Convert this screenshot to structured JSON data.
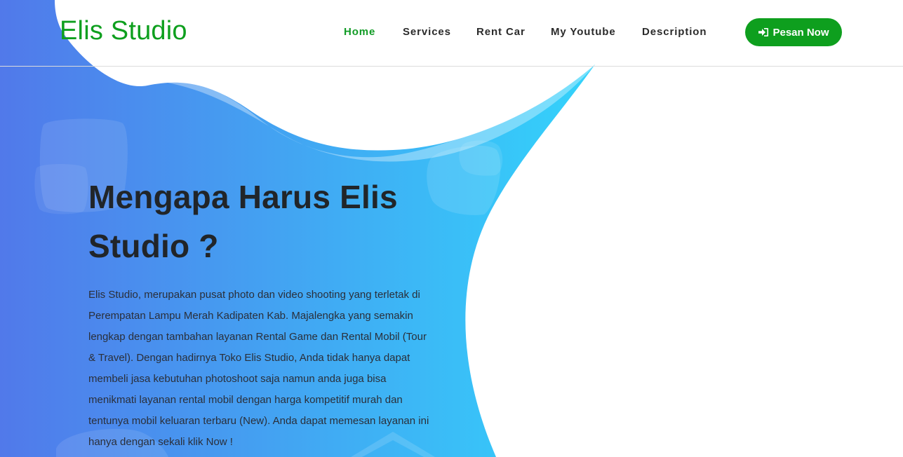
{
  "brand": {
    "name": "Elis Studio",
    "color": "#0e9f1e"
  },
  "nav": {
    "items": [
      {
        "label": "Home",
        "active": true
      },
      {
        "label": "Services",
        "active": false
      },
      {
        "label": "Rent Car",
        "active": false
      },
      {
        "label": "My Youtube",
        "active": false
      },
      {
        "label": "Description",
        "active": false
      }
    ],
    "cta": {
      "label": "Pesan Now",
      "icon": "sign-in-icon"
    }
  },
  "hero": {
    "title": "Mengapa Harus Elis Studio ?",
    "description": "Elis Studio, merupakan pusat photo dan video shooting yang terletak di Perempatan Lampu Merah Kadipaten Kab. Majalengka yang semakin lengkap dengan tambahan layanan Rental Game dan Rental Mobil (Tour & Travel). Dengan hadirnya Toko Elis Studio, Anda tidak hanya dapat membeli jasa kebutuhan photoshoot saja namun anda juga bisa menikmati layanan rental mobil dengan harga kompetitif murah dan tentunya mobil keluaran terbaru (New). Anda dapat memesan layanan ini hanya dengan sekali klik Now !"
  },
  "colors": {
    "gradient_start": "#5179ea",
    "gradient_end": "#33d3fb",
    "accent_green": "#0e9f1e",
    "active_nav": "#119b25"
  }
}
